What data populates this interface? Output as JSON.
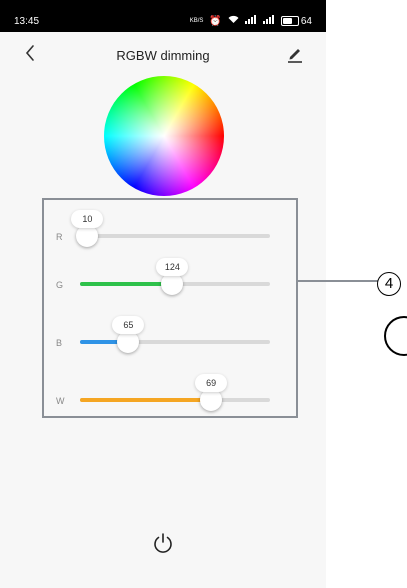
{
  "statusbar": {
    "time": "13:45",
    "net_speed": "KB/S",
    "battery": "64",
    "battery_level": 0.64
  },
  "header": {
    "title": "RGBW dimming"
  },
  "sliders": [
    {
      "label": "R",
      "value": "10",
      "value_num": 10,
      "max": 255,
      "color": "#e02b2b"
    },
    {
      "label": "G",
      "value": "124",
      "value_num": 124,
      "max": 255,
      "color": "#2ec14a"
    },
    {
      "label": "B",
      "value": "65",
      "value_num": 65,
      "max": 255,
      "color": "#2f93e6"
    },
    {
      "label": "W",
      "value": "69",
      "value_num": 69,
      "max": 100,
      "color": "#f5a623"
    }
  ],
  "annotation": {
    "number": "4"
  },
  "colors": {
    "track": "#d9d9d9",
    "highlight": "#8a8f96"
  }
}
